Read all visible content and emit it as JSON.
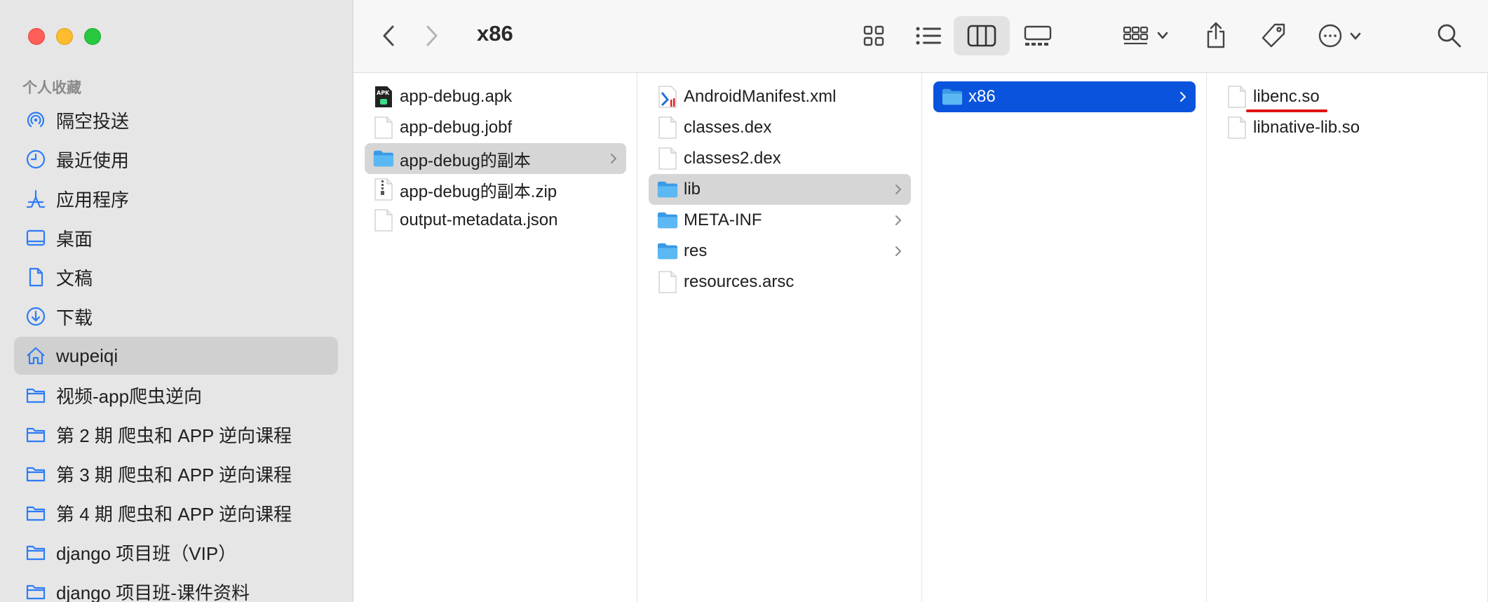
{
  "sidebar": {
    "section_title": "个人收藏",
    "items": [
      {
        "label": "隔空投送",
        "icon": "airdrop-icon"
      },
      {
        "label": "最近使用",
        "icon": "clock-icon"
      },
      {
        "label": "应用程序",
        "icon": "applications-icon"
      },
      {
        "label": "桌面",
        "icon": "desktop-icon"
      },
      {
        "label": "文稿",
        "icon": "document-icon"
      },
      {
        "label": "下载",
        "icon": "download-icon"
      },
      {
        "label": "wupeiqi",
        "icon": "home-icon",
        "selected": true
      },
      {
        "label": "视频-app爬虫逆向",
        "icon": "folder-icon"
      },
      {
        "label": "第 2 期 爬虫和 APP 逆向课程",
        "icon": "folder-icon"
      },
      {
        "label": "第 3 期 爬虫和 APP 逆向课程",
        "icon": "folder-icon"
      },
      {
        "label": "第 4 期 爬虫和 APP 逆向课程",
        "icon": "folder-icon"
      },
      {
        "label": "django 项目班（VIP）",
        "icon": "folder-icon"
      },
      {
        "label": "django 项目班-课件资料",
        "icon": "folder-icon"
      }
    ]
  },
  "toolbar": {
    "title": "x86",
    "active_view": "columns"
  },
  "columns": [
    {
      "items": [
        {
          "label": "app-debug.apk",
          "type": "apk"
        },
        {
          "label": "app-debug.jobf",
          "type": "file"
        },
        {
          "label": "app-debug的副本",
          "type": "folder",
          "selected": "gray",
          "has_children": true
        },
        {
          "label": "app-debug的副本.zip",
          "type": "zip"
        },
        {
          "label": "output-metadata.json",
          "type": "file"
        }
      ]
    },
    {
      "items": [
        {
          "label": "AndroidManifest.xml",
          "type": "xml"
        },
        {
          "label": "classes.dex",
          "type": "file"
        },
        {
          "label": "classes2.dex",
          "type": "file"
        },
        {
          "label": "lib",
          "type": "folder",
          "selected": "gray",
          "has_children": true
        },
        {
          "label": "META-INF",
          "type": "folder",
          "has_children": true
        },
        {
          "label": "res",
          "type": "folder",
          "has_children": true
        },
        {
          "label": "resources.arsc",
          "type": "file"
        }
      ]
    },
    {
      "items": [
        {
          "label": "x86",
          "type": "folder",
          "selected": "blue",
          "has_children": true
        }
      ]
    },
    {
      "items": [
        {
          "label": "libenc.so",
          "type": "file",
          "underlined": true
        },
        {
          "label": "libnative-lib.so",
          "type": "file"
        }
      ]
    }
  ],
  "colors": {
    "selection_blue": "#0a53dd",
    "folder_blue": "#4fb1f0",
    "underline_red": "#e11414"
  }
}
